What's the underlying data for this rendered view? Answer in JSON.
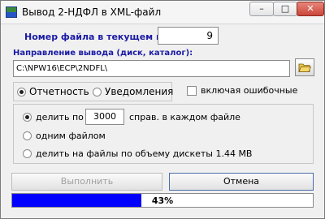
{
  "window": {
    "title": "Вывод 2-НДФЛ в XML-файл",
    "controls": {
      "minimize": "–",
      "maximize": "□",
      "close": "✕"
    }
  },
  "file_number": {
    "label": "Номер файла в текущем году -",
    "value": "9"
  },
  "output_dir": {
    "label": "Направление вывода (диск, каталог):",
    "value": "C:\\NPW16\\ECP\\2NDFL\\"
  },
  "mode": {
    "options": [
      {
        "label": "Отчетность",
        "selected": true
      },
      {
        "label": "Уведомления",
        "selected": false
      }
    ]
  },
  "include_errors": {
    "label": "включая ошибочные",
    "checked": false
  },
  "split": {
    "by_count": {
      "label_before": "делить по",
      "value": "3000",
      "label_after": "справ. в каждом файле",
      "selected": true
    },
    "one_file": {
      "label": "одним файлом",
      "selected": false
    },
    "by_floppy": {
      "label": "делить на файлы по объему дискеты 1.44 MB",
      "selected": false
    }
  },
  "buttons": {
    "run": "Выполнить",
    "cancel": "Отмена"
  },
  "progress": {
    "percent": 43,
    "text": "43%"
  },
  "colors": {
    "label_blue": "#1a1aa6",
    "progress_fill": "#0000ff"
  }
}
